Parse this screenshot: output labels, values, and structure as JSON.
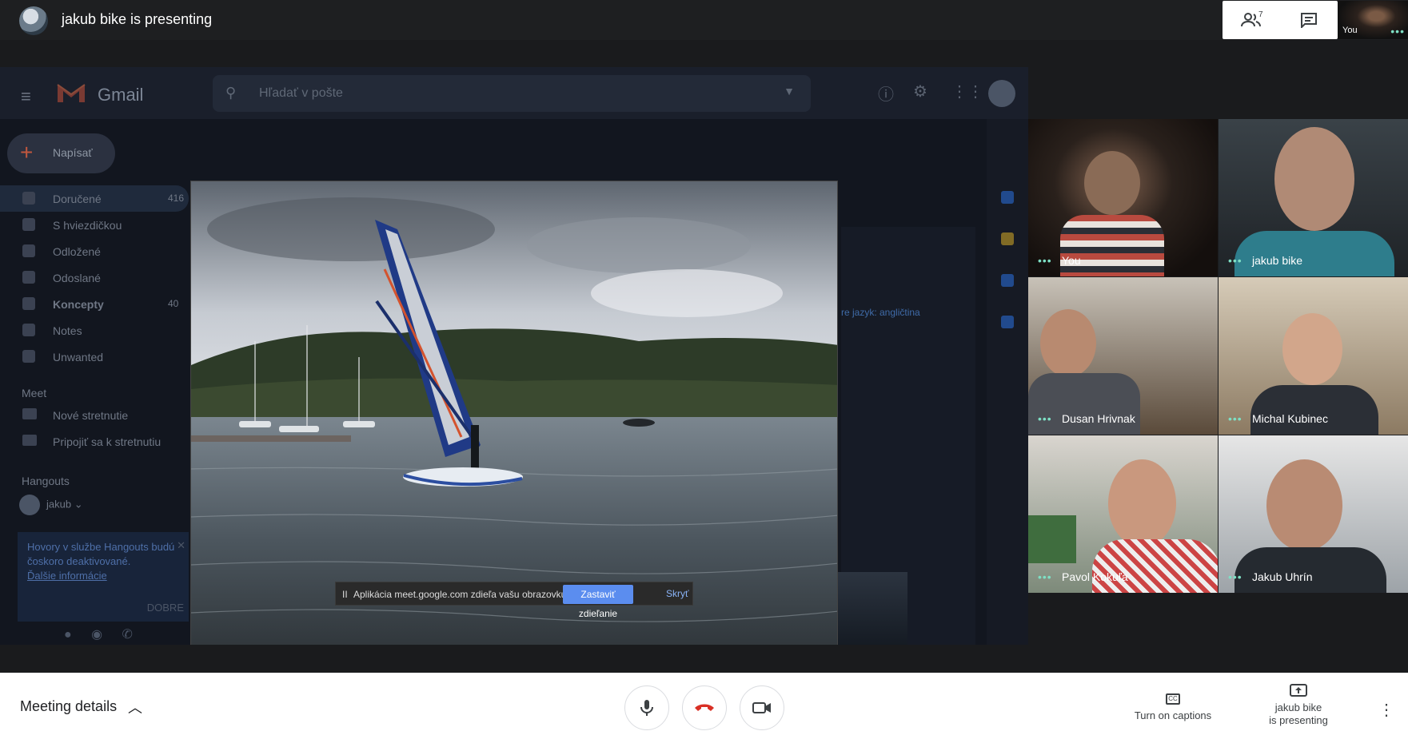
{
  "topbar": {
    "title": "jakub bike is presenting",
    "people_count": "7",
    "self_label": "You",
    "self_dots": "•••"
  },
  "gmail": {
    "app_name": "Gmail",
    "search_placeholder": "Hľadať v pošte",
    "compose_label": "Napísať",
    "nav": [
      {
        "label": "Doručené",
        "count": "416"
      },
      {
        "label": "S hviezdičkou",
        "count": ""
      },
      {
        "label": "Odložené",
        "count": ""
      },
      {
        "label": "Odoslané",
        "count": ""
      },
      {
        "label": "Koncepty",
        "count": "40"
      },
      {
        "label": "Notes",
        "count": ""
      },
      {
        "label": "Unwanted",
        "count": ""
      }
    ],
    "meet_section": "Meet",
    "meet_items": [
      "Nové stretnutie",
      "Pripojiť sa k stretnutiu"
    ],
    "hangouts_section": "Hangouts",
    "hangouts_user": "jakub",
    "notice_text": "Hovory v službe Hangouts budú čoskoro deaktivované.",
    "notice_link": "Ďalšie informácie",
    "notice_ok": "DOBRE",
    "lang_text": "re jazyk: angličtina",
    "rail_colors": [
      "#2a6bd4",
      "#c9a227",
      "#2a6bd4",
      "#2a6bd4"
    ]
  },
  "share_bar": {
    "pause": "II",
    "message": "Aplikácia meet.google.com zdieľa vašu obrazovku.",
    "stop_label": "Zastaviť zdieľanie",
    "hide_label": "Skryť"
  },
  "participants": [
    {
      "name": "You",
      "dots": "•••"
    },
    {
      "name": "jakub bike",
      "dots": "•••"
    },
    {
      "name": "Dusan Hrivnak",
      "dots": "•••"
    },
    {
      "name": "Michal Kubinec",
      "dots": "•••"
    },
    {
      "name": "Pavol Kokuľa",
      "dots": "•••"
    },
    {
      "name": "Jakub Uhrín",
      "dots": "•••"
    }
  ],
  "bottombar": {
    "meeting_details": "Meeting details",
    "captions_label": "Turn on captions",
    "presenting_label_1": "jakub bike",
    "presenting_label_2": "is presenting",
    "more": "⋮"
  }
}
